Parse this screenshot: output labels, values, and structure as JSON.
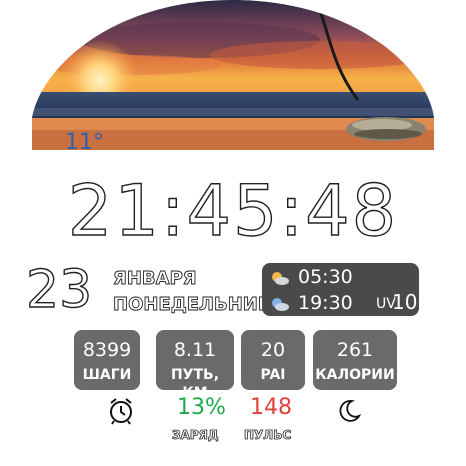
{
  "weather": {
    "temperature": "11°"
  },
  "time": "21:45:48",
  "date": {
    "day": "23",
    "month": "ЯНВАРЯ",
    "weekday": "ПОНЕДЕЛЬНИК"
  },
  "sun": {
    "sunrise": "05:30",
    "sunset": "19:30",
    "uv_label": "UV",
    "uv_value": "10"
  },
  "tiles": [
    {
      "value": "8399",
      "label": "ШАГИ"
    },
    {
      "value": "8.11",
      "label": "ПУТЬ, КМ"
    },
    {
      "value": "20",
      "label": "PAI"
    },
    {
      "value": "261",
      "label": "КАЛОРИИ"
    }
  ],
  "status": {
    "battery_value": "13%",
    "battery_label": "ЗАРЯД",
    "pulse_value": "148",
    "pulse_label": "ПУЛЬС",
    "battery_color": "#1faa4a",
    "pulse_color": "#e0403a"
  },
  "colors": {
    "tile_bg": "#6a6a6a",
    "panel_bg": "#4a4a4a",
    "temp_color": "#2f5fb0"
  }
}
